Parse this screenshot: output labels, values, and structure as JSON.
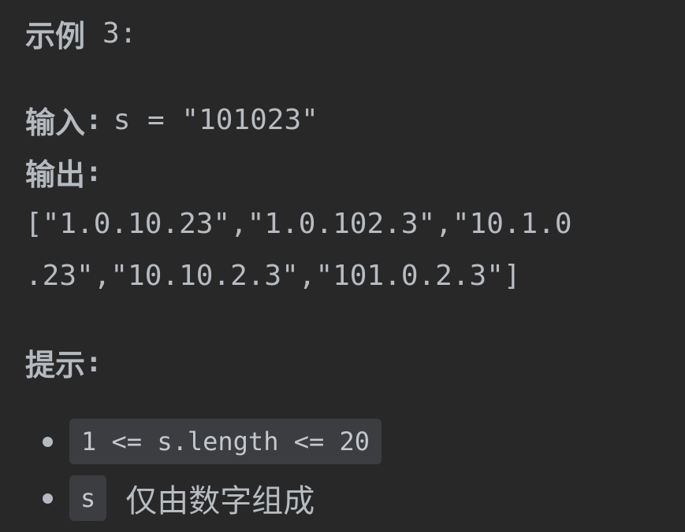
{
  "example": {
    "title": "示例",
    "number": "3:"
  },
  "input": {
    "label": "输入",
    "colon": ":",
    "expression": "s = \"101023\""
  },
  "output": {
    "label": "输出",
    "colon": ":",
    "result_line_1": "[\"1.0.10.23\",\"1.0.102.3\",\"10.1.0",
    "result_line_2": ".23\",\"10.10.2.3\",\"101.0.2.3\"]"
  },
  "hints": {
    "label": "提示",
    "colon": ":",
    "items": [
      {
        "code": "1 <= s.length <= 20",
        "text": ""
      },
      {
        "code": "s",
        "text": "仅由数字组成"
      }
    ]
  },
  "colors": {
    "background": "#282828",
    "text": "#b7bcc2",
    "code_chip": "#3b3d40"
  }
}
